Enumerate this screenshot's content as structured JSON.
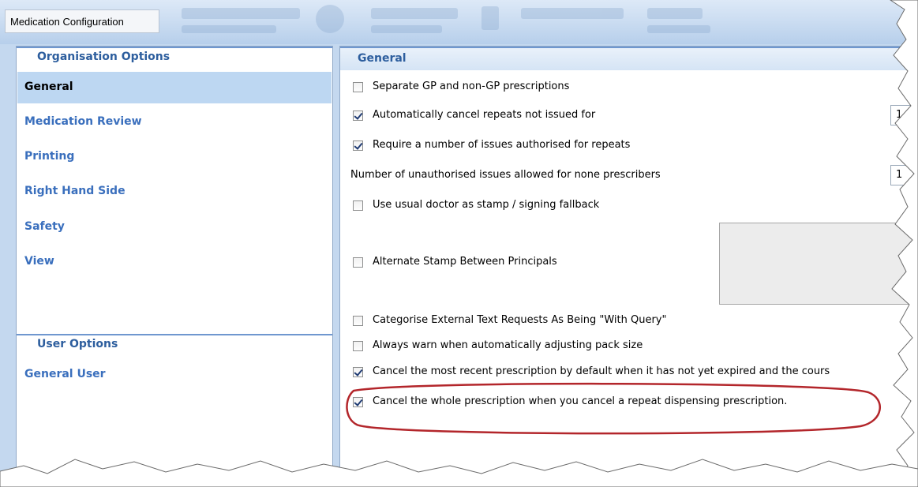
{
  "window": {
    "title": "Medication Configuration"
  },
  "nav": {
    "org_header": "Organisation Options",
    "org_items": [
      {
        "label": "General",
        "selected": true
      },
      {
        "label": "Medication Review",
        "selected": false
      },
      {
        "label": "Printing",
        "selected": false
      },
      {
        "label": "Right Hand Side",
        "selected": false
      },
      {
        "label": "Safety",
        "selected": false
      },
      {
        "label": "View",
        "selected": false
      }
    ],
    "user_header": "User Options",
    "user_items": [
      {
        "label": "General User",
        "selected": false
      }
    ]
  },
  "content": {
    "header": "General",
    "options": {
      "separate_gp": {
        "label": "Separate GP and non-GP prescriptions",
        "checked": false
      },
      "auto_cancel": {
        "label": "Automatically cancel repeats not issued for",
        "checked": true,
        "value": "1"
      },
      "require_issues": {
        "label": "Require a number of issues authorised for repeats",
        "checked": true
      },
      "unauth_issues": {
        "label": "Number of unauthorised issues allowed for none prescribers",
        "value": "1"
      },
      "usual_doctor": {
        "label": "Use usual doctor as stamp / signing fallback",
        "checked": false
      },
      "alternate_stamp": {
        "label": "Alternate Stamp Between Principals",
        "checked": false
      },
      "categorise_ext": {
        "label": "Categorise External Text Requests As Being \"With Query\"",
        "checked": false
      },
      "warn_pack": {
        "label": "Always warn when automatically adjusting pack size",
        "checked": false
      },
      "cancel_recent": {
        "label": "Cancel the most recent prescription by default when it has not yet expired and the cours",
        "checked": true
      },
      "cancel_whole": {
        "label": "Cancel the whole prescription when you cancel a repeat dispensing prescription.",
        "checked": true,
        "highlighted": true
      }
    }
  },
  "colors": {
    "accent": "#3a6fbd",
    "selected_bg": "#bdd7f2",
    "highlight_ring": "#b3262b"
  }
}
